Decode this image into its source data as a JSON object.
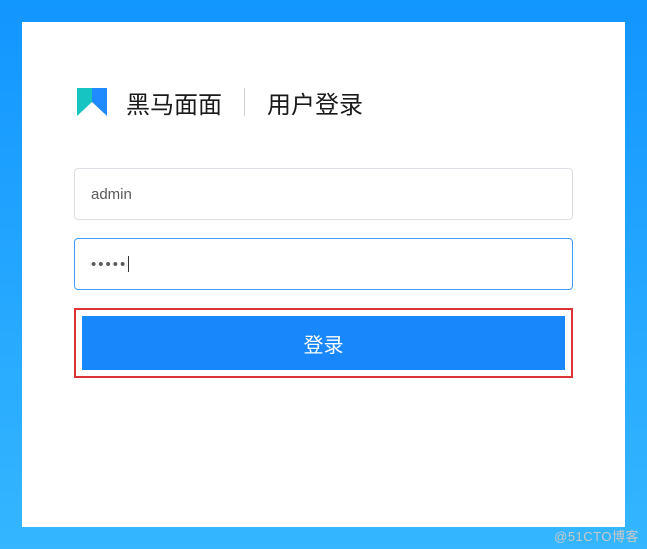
{
  "header": {
    "app_name": "黑马面面",
    "page_title": "用户登录"
  },
  "form": {
    "username_value": "admin",
    "password_masked": "•••••",
    "login_label": "登录"
  },
  "colors": {
    "frame_bg": "#1296ff",
    "button_bg": "#1787fb",
    "highlight_border": "#d33",
    "input_focus": "#409eff"
  },
  "watermark": "@51CTO博客"
}
